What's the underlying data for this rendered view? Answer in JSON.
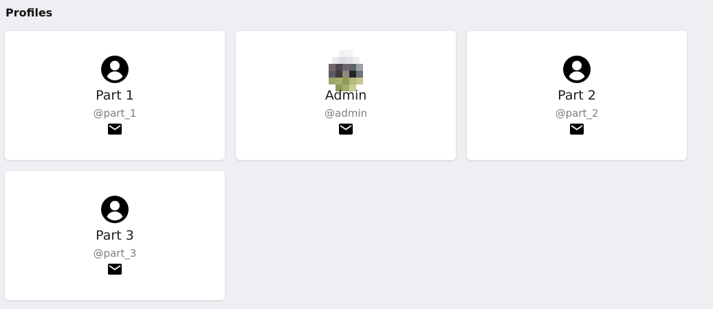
{
  "page": {
    "title": "Profiles"
  },
  "colors": {
    "background": "#efeef3",
    "card": "#ffffff",
    "text": "#1c1c1c",
    "handle": "#7b7b83"
  },
  "profiles": [
    {
      "name": "Part 1",
      "handle": "@part_1",
      "avatar": "account-circle-icon",
      "contact_icon": "email-icon"
    },
    {
      "name": "Admin",
      "handle": "@admin",
      "avatar": "profile-photo",
      "contact_icon": "email-icon"
    },
    {
      "name": "Part 2",
      "handle": "@part_2",
      "avatar": "account-circle-icon",
      "contact_icon": "email-icon"
    },
    {
      "name": "Part 3",
      "handle": "@part_3",
      "avatar": "account-circle-icon",
      "contact_icon": "email-icon"
    }
  ]
}
